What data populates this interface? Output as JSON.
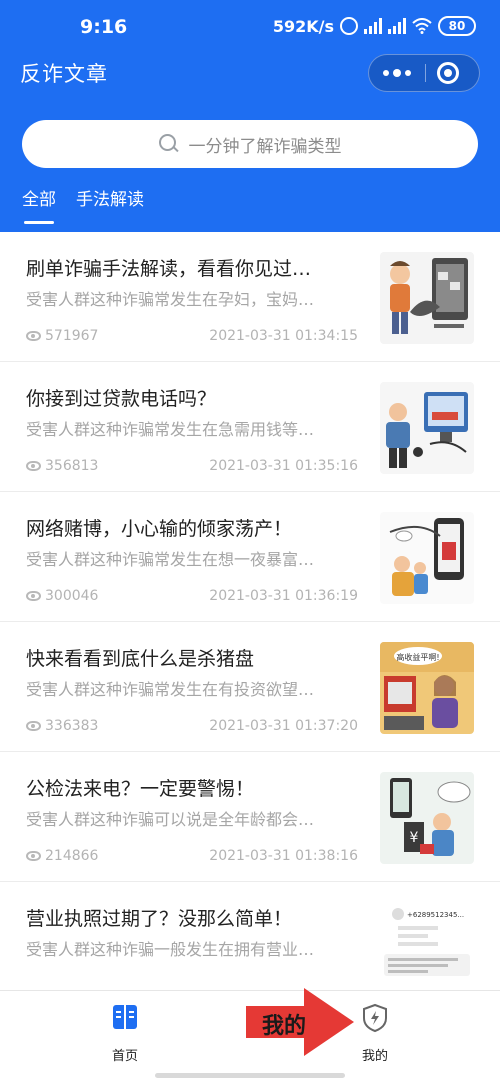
{
  "status_bar": {
    "time": "9:16",
    "network_speed": "592K/s",
    "signal_label_1": "HD",
    "signal_label_2": "HD",
    "battery": "80"
  },
  "header": {
    "title": "反诈文章",
    "capsule_icons": [
      "more-icon",
      "close-circle-icon"
    ]
  },
  "search": {
    "placeholder": "一分钟了解诈骗类型",
    "icon": "search-icon"
  },
  "tabs": [
    {
      "label": "全部",
      "active": true
    },
    {
      "label": "手法解读",
      "active": false
    }
  ],
  "articles": [
    {
      "title": "刷单诈骗手法解读，看看你见过…",
      "desc": "受害人群这种诈骗常发生在孕妇，宝妈…",
      "views": "571967",
      "date": "2021-03-31 01:34:15",
      "thumb": "cartoon-scam-illustration"
    },
    {
      "title": "你接到过贷款电话吗？",
      "desc": "受害人群这种诈骗常发生在急需用钱等…",
      "views": "356813",
      "date": "2021-03-31 01:35:16",
      "thumb": "cartoon-loan-illustration"
    },
    {
      "title": "网络赌博，小心输的倾家荡产！",
      "desc": "受害人群这种诈骗常发生在想一夜暴富…",
      "views": "300046",
      "date": "2021-03-31 01:36:19",
      "thumb": "cartoon-gambling-illustration"
    },
    {
      "title": "快来看看到底什么是杀猪盘",
      "desc": "受害人群这种诈骗常发生在有投资欲望…",
      "views": "336383",
      "date": "2021-03-31 01:37:20",
      "thumb": "cartoon-pig-butchering-illustration"
    },
    {
      "title": "公检法来电？一定要警惕！",
      "desc": "受害人群这种诈骗可以说是全年龄都会…",
      "views": "214866",
      "date": "2021-03-31 01:38:16",
      "thumb": "cartoon-police-call-illustration"
    },
    {
      "title": "营业执照过期了？没那么简单！",
      "desc": "受害人群这种诈骗一般发生在拥有营业…",
      "views": "",
      "date": "",
      "thumb": "sms-screenshot"
    }
  ],
  "thumb_texts": {
    "a4_bubble": "高收益平啊!",
    "a6_phone": "+6289512345..."
  },
  "bottom_nav": [
    {
      "label": "首页",
      "icon": "book-icon"
    },
    {
      "label": "我的",
      "icon": "shield-icon"
    }
  ],
  "annotation": {
    "text": "我的",
    "color": "#e53935"
  },
  "colors": {
    "primary": "#1e6ef2",
    "text": "#222222",
    "secondary_text": "#a6a6a6"
  }
}
